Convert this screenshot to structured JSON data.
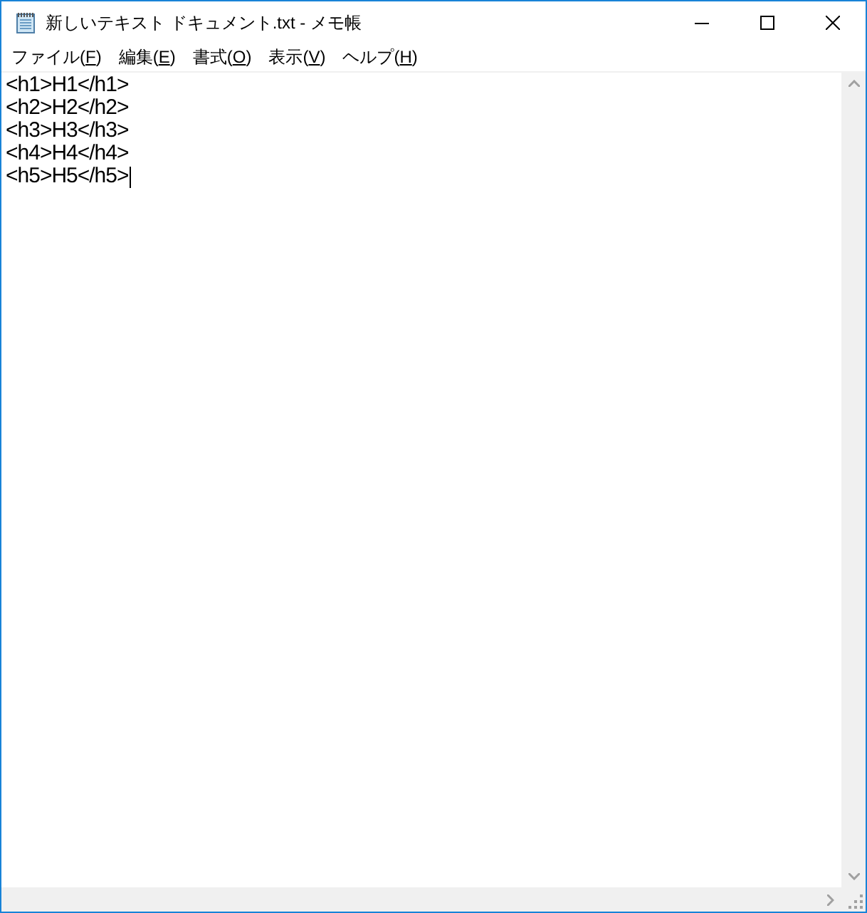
{
  "window": {
    "title": "新しいテキスト ドキュメント.txt - メモ帳"
  },
  "menu": [
    {
      "before": "ファイル(",
      "key": "F",
      "after": ")"
    },
    {
      "before": "編集(",
      "key": "E",
      "after": ")"
    },
    {
      "before": "書式(",
      "key": "O",
      "after": ")"
    },
    {
      "before": "表示(",
      "key": "V",
      "after": ")"
    },
    {
      "before": "ヘルプ(",
      "key": "H",
      "after": ")"
    }
  ],
  "editor": {
    "lines": [
      {
        "text": "<h1>H1</h1>",
        "caret": false
      },
      {
        "text": "<h2>H2</h2>",
        "caret": false
      },
      {
        "text": "<h3>H3</h3>",
        "caret": false
      },
      {
        "text": "<h4>H4</h4>",
        "caret": false
      },
      {
        "text": "<h5>H5</h5>",
        "caret": true
      }
    ]
  }
}
